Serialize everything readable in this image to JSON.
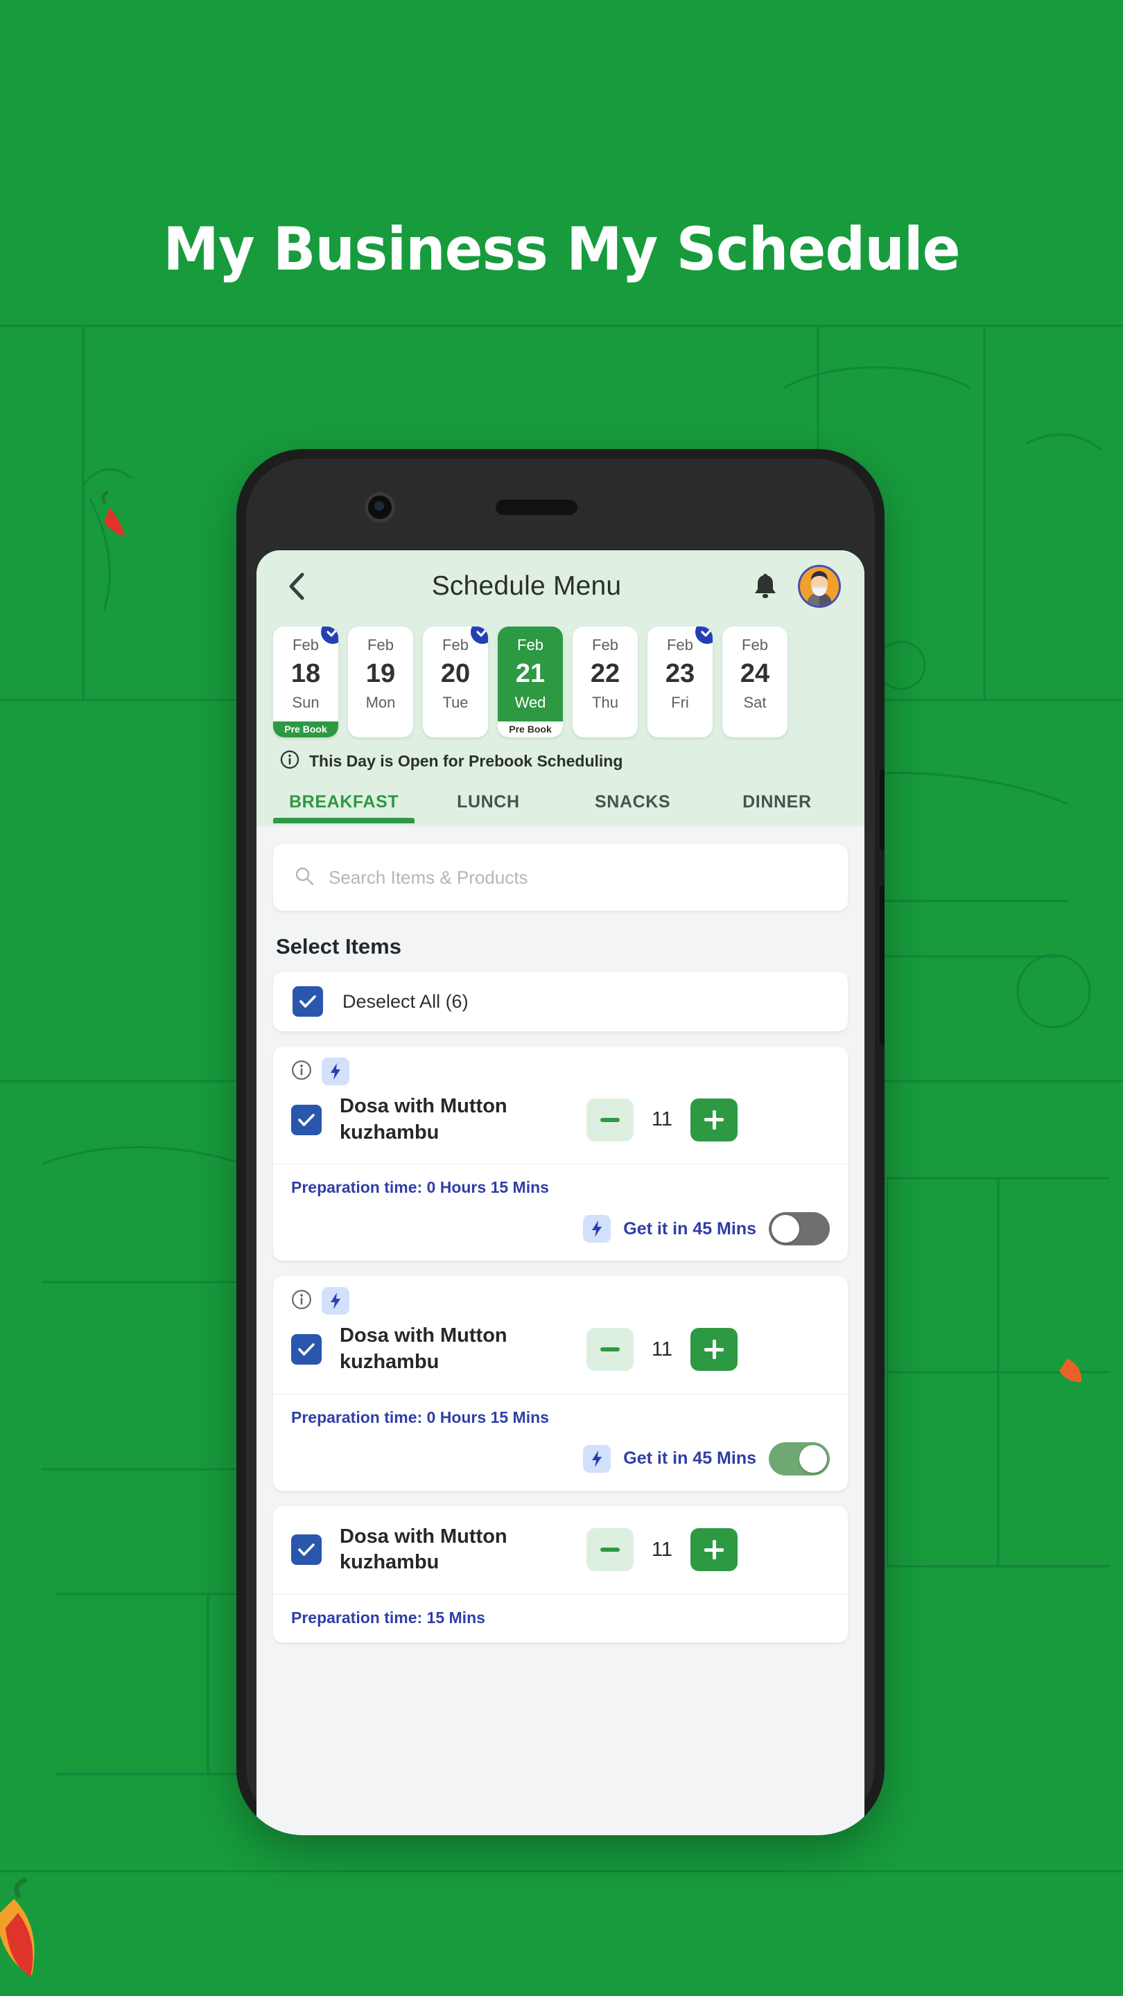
{
  "poster": {
    "headline": "My Business My Schedule",
    "background_color": "#179B3C"
  },
  "app": {
    "header": {
      "back_icon": "chevron-left-icon",
      "title": "Schedule Menu",
      "bell_icon": "bell-icon",
      "avatar_icon": "user-avatar"
    },
    "dates": [
      {
        "month": "Feb",
        "day": "18",
        "weekday": "Sun",
        "ribbon": "Pre Book",
        "selected": false,
        "checked": true
      },
      {
        "month": "Feb",
        "day": "19",
        "weekday": "Mon",
        "ribbon": "",
        "selected": false,
        "checked": false
      },
      {
        "month": "Feb",
        "day": "20",
        "weekday": "Tue",
        "ribbon": "",
        "selected": false,
        "checked": true
      },
      {
        "month": "Feb",
        "day": "21",
        "weekday": "Wed",
        "ribbon": "Pre Book",
        "selected": true,
        "checked": false
      },
      {
        "month": "Feb",
        "day": "22",
        "weekday": "Thu",
        "ribbon": "",
        "selected": false,
        "checked": false
      },
      {
        "month": "Feb",
        "day": "23",
        "weekday": "Fri",
        "ribbon": "",
        "selected": false,
        "checked": true
      },
      {
        "month": "Feb",
        "day": "24",
        "weekday": "Sat",
        "ribbon": "",
        "selected": false,
        "checked": false
      }
    ],
    "info_note": {
      "icon": "info-circle-icon",
      "text": "This Day is Open for Prebook Scheduling"
    },
    "tabs": [
      {
        "label": "BREAKFAST",
        "active": true
      },
      {
        "label": "LUNCH",
        "active": false
      },
      {
        "label": "SNACKS",
        "active": false
      },
      {
        "label": "DINNER",
        "active": false
      }
    ],
    "search": {
      "icon": "search-icon",
      "placeholder": "Search Items & Products",
      "value": ""
    },
    "section_title": "Select Items",
    "deselect_all": {
      "label": "Deselect All (6)",
      "checked": true
    },
    "items": [
      {
        "name": "Dosa with Mutton kuzhambu",
        "checked": true,
        "quantity": "11",
        "has_flags": true,
        "info_icon": "info-circle-icon",
        "bolt_icon": "lightning-bolt-icon",
        "prep_time": "Preparation time: 0 Hours 15 Mins",
        "express_label": "Get it in 45 Mins",
        "express_on": false
      },
      {
        "name": "Dosa with Mutton kuzhambu",
        "checked": true,
        "quantity": "11",
        "has_flags": true,
        "info_icon": "info-circle-icon",
        "bolt_icon": "lightning-bolt-icon",
        "prep_time": "Preparation time: 0 Hours 15 Mins",
        "express_label": "Get it in 45 Mins",
        "express_on": true
      },
      {
        "name": "Dosa with Mutton kuzhambu",
        "checked": true,
        "quantity": "11",
        "has_flags": false,
        "prep_time": "Preparation time: 15 Mins",
        "express_label": "",
        "express_on": false
      }
    ],
    "colors": {
      "brand_green": "#2d9943",
      "poster_green": "#179B3C",
      "header_mint": "#dff0e3",
      "checkbox_blue": "#2b56ad",
      "badge_blue": "#2440b5",
      "accent_indigo": "#2f3fa6"
    }
  }
}
